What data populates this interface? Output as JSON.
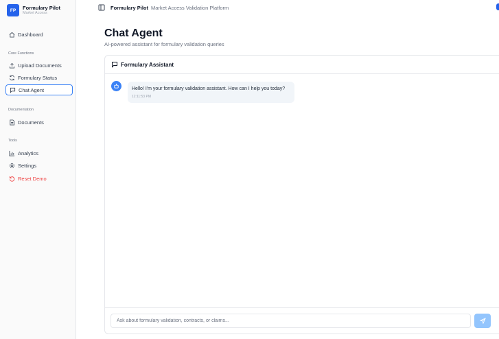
{
  "brand": {
    "logo_text": "FP",
    "name": "Formulary Pilot",
    "subtitle": "Market Access"
  },
  "sidebar": {
    "dashboard": {
      "label": "Dashboard",
      "icon": "home-icon"
    },
    "core_label": "Core Functions",
    "core_items": [
      {
        "label": "Upload Documents",
        "icon": "upload-icon"
      },
      {
        "label": "Formulary Status",
        "icon": "refresh-icon"
      },
      {
        "label": "Chat Agent",
        "icon": "chat-icon",
        "active": true
      }
    ],
    "docs_label": "Documentation",
    "docs_items": [
      {
        "label": "Documents",
        "icon": "document-icon"
      }
    ],
    "tools_label": "Tools",
    "tools_items": [
      {
        "label": "Analytics",
        "icon": "bar-chart-icon"
      },
      {
        "label": "Settings",
        "icon": "gear-icon"
      },
      {
        "label": "Reset Demo",
        "icon": "reset-icon",
        "danger": true
      }
    ]
  },
  "topbar": {
    "title": "Formulary Pilot",
    "subtitle": "Market Access Validation Platform"
  },
  "page": {
    "title": "Chat Agent",
    "subtitle": "AI-powered assistant for formulary validation queries"
  },
  "chat": {
    "header": "Formulary Assistant",
    "messages": [
      {
        "sender": "assistant",
        "text": "Hello! I'm your formulary validation assistant. How can I help you today?",
        "time": "12:11:53 PM"
      }
    ],
    "input_placeholder": "Ask about formulary validation, contracts, or claims..."
  },
  "colors": {
    "accent": "#2563eb",
    "active_border": "#3b82f6",
    "danger": "#ef4444",
    "send_button": "#93c5fd",
    "bubble_bg": "#f1f5f9"
  }
}
